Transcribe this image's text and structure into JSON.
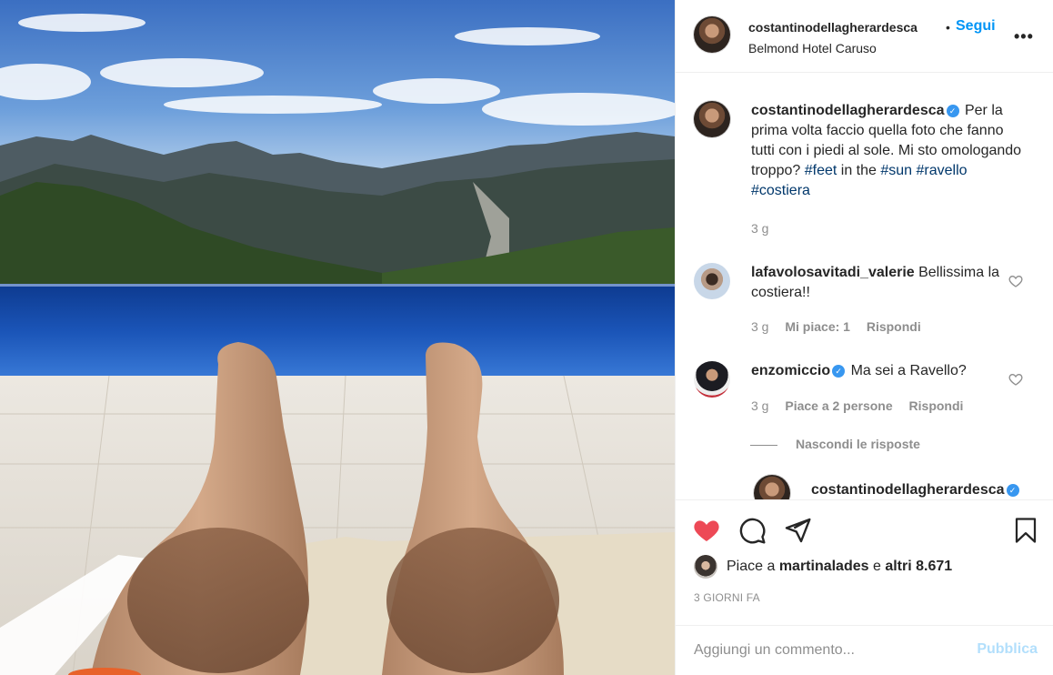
{
  "post": {
    "username": "costantinodellagherardesca",
    "follow_label": "Segui",
    "separator": "•",
    "location": "Belmond Hotel Caruso",
    "more_icon": "more-options-icon",
    "more_label": "•••"
  },
  "caption": {
    "username": "costantinodellagherardesca",
    "text_before": "Per la prima volta faccio quella foto che fanno tutti con i piedi al sole. Mi sto omologando troppo? ",
    "tag_feet": "#feet",
    "in_the": " in the ",
    "tag_sun": "#sun",
    "tag_ravello": "#ravello",
    "tag_costiera": "#costiera",
    "time": "3 g"
  },
  "comments": [
    {
      "username": "lafavolosavitadi_valerie",
      "text": "Bellissima la costiera!!",
      "time": "3 g",
      "likes": "Mi piace: 1",
      "reply": "Rispondi"
    },
    {
      "username": "enzomiccio",
      "verified": true,
      "text": "Ma sei a Ravello?",
      "time": "3 g",
      "likes": "Piace a 2 persone",
      "reply": "Rispondi"
    }
  ],
  "hide_replies": "Nascondi le risposte",
  "reply_preview": {
    "username": "costantinodellagherardesca"
  },
  "actions": {
    "liked": true,
    "like_color": "#ed4956",
    "likes_prefix": "Piace a ",
    "likes_user": "martinalades",
    "likes_and": " e ",
    "likes_others": "altri 8.671",
    "date": "3 GIORNI FA"
  },
  "add_comment": {
    "placeholder": "Aggiungi un commento...",
    "publish": "Pubblica"
  },
  "colors": {
    "accent": "#0095f6",
    "verified": "#3897f0",
    "hashtag": "#00376b",
    "muted": "#8e8e8e"
  }
}
